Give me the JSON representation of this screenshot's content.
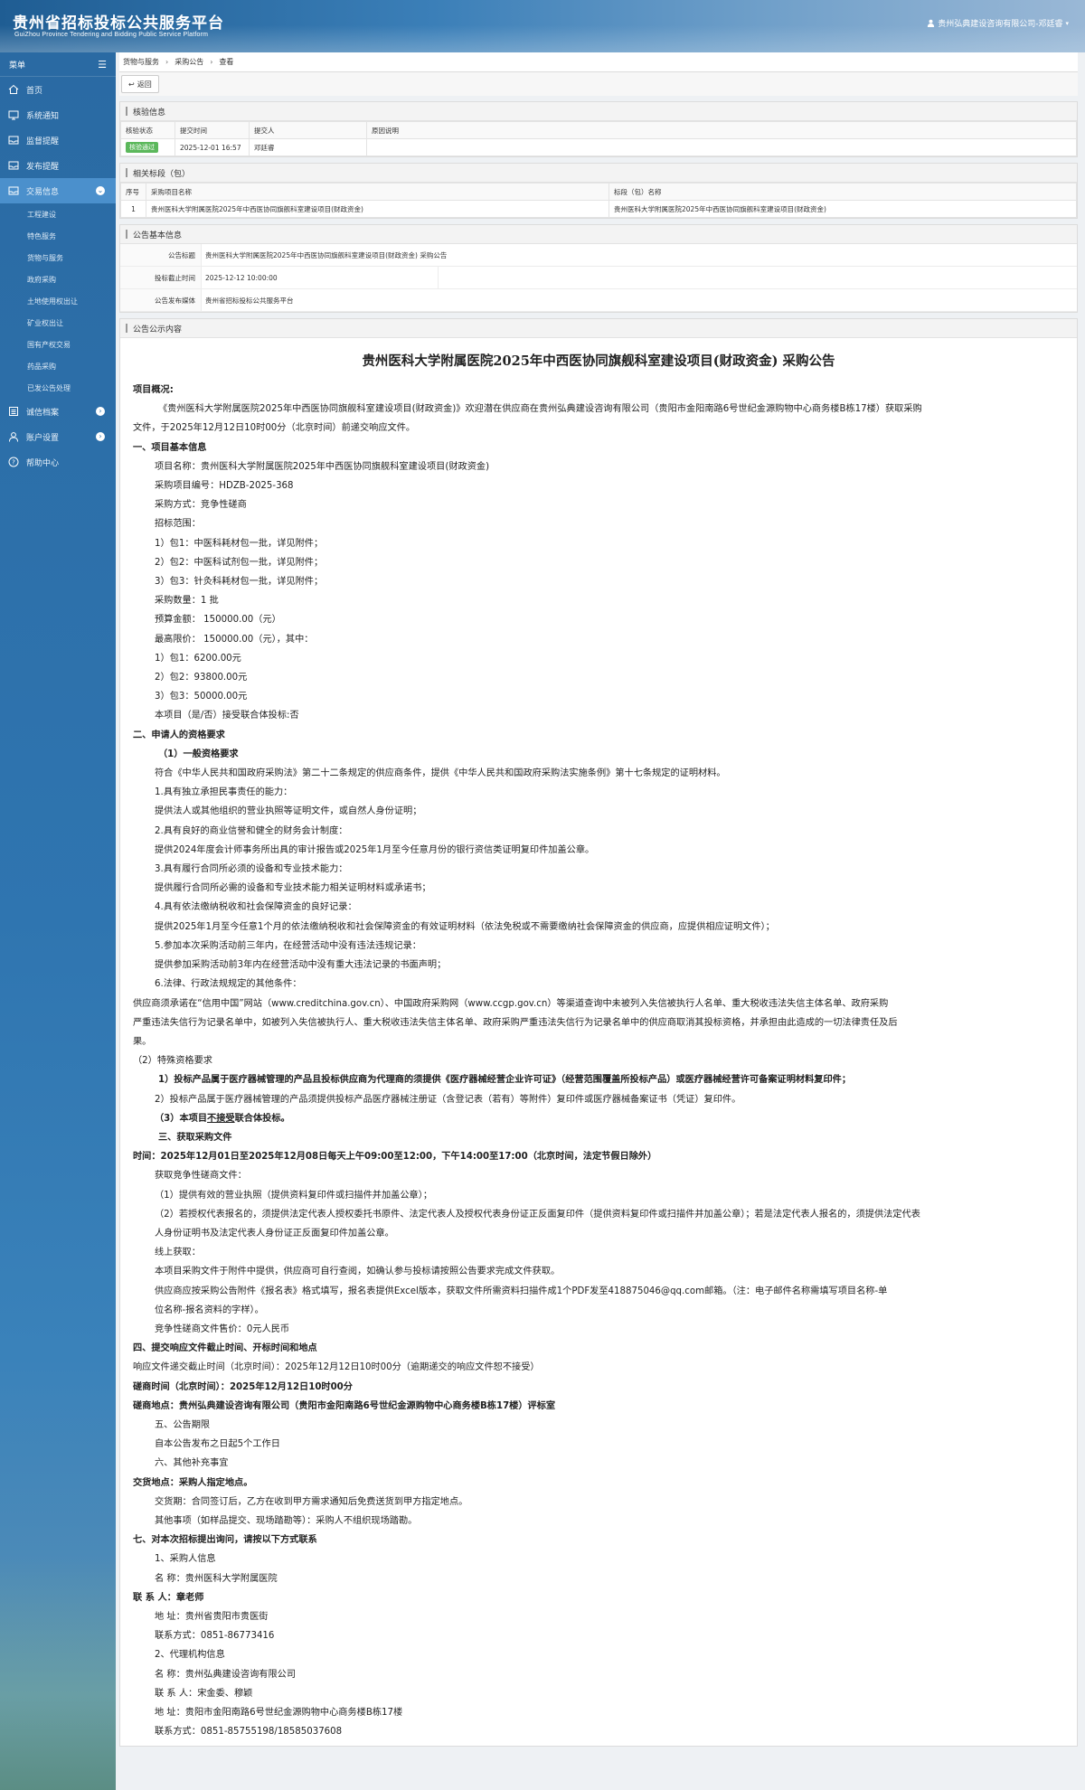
{
  "header": {
    "title": "贵州省招标投标公共服务平台",
    "subtitle": "GuiZhou Province Tendering and Bidding Public Service Platform",
    "user": "贵州弘典建设咨询有限公司-邓廷睿"
  },
  "sidebar": {
    "menu_label": "菜单",
    "items": [
      {
        "label": "首页",
        "icon": "home-icon"
      },
      {
        "label": "系统通知",
        "icon": "monitor-icon"
      },
      {
        "label": "监督提醒",
        "icon": "inbox-icon"
      },
      {
        "label": "发布提醒",
        "icon": "inbox-icon"
      },
      {
        "label": "交易信息",
        "icon": "inbox-icon",
        "active": true
      }
    ],
    "subitems": [
      "工程建设",
      "特色服务",
      "货物与服务",
      "政府采购",
      "土地使用权出让",
      "矿业权出让",
      "国有产权交易",
      "药品采购",
      "已发公告处理"
    ],
    "items2": [
      {
        "label": "诚信档案",
        "icon": "list-icon"
      },
      {
        "label": "账户设置",
        "icon": "user-icon"
      },
      {
        "label": "帮助中心",
        "icon": "help-icon"
      }
    ]
  },
  "breadcrumb": [
    "货物与服务",
    "采购公告",
    "查看"
  ],
  "toolbar": {
    "back_label": "返回"
  },
  "verify": {
    "title": "核验信息",
    "headers": [
      "核验状态",
      "提交时间",
      "提交人",
      "原因说明"
    ],
    "row": {
      "status": "核验通过",
      "time": "2025-12-01 16:57",
      "person": "邓廷睿",
      "reason": ""
    }
  },
  "sections": {
    "title": "相关标段（包）",
    "headers": [
      "序号",
      "采购项目名称",
      "标段（包）名称"
    ],
    "row": {
      "no": "1",
      "project": "贵州医科大学附属医院2025年中西医协同旗舰科室建设项目(财政资金)",
      "section": "贵州医科大学附属医院2025年中西医协同旗舰科室建设项目(财政资金)"
    }
  },
  "basic": {
    "title": "公告基本信息",
    "rows": [
      {
        "label": "公告标题",
        "value": "贵州医科大学附属医院2025年中西医协同旗舰科室建设项目(财政资金) 采购公告"
      },
      {
        "label": "投标截止时间",
        "value": "2025-12-12 10:00:00"
      },
      {
        "label": "公告发布媒体",
        "value": "贵州省招标投标公共服务平台"
      }
    ]
  },
  "content": {
    "title": "公告公示内容",
    "doc_title": "贵州医科大学附属医院2025年中西医协同旗舰科室建设项目(财政资金)      采购公告",
    "lines": [
      "项目概况:",
      "《贵州医科大学附属医院2025年中西医协同旗舰科室建设项目(财政资金)》欢迎潜在供应商在贵州弘典建设咨询有限公司（贵阳市金阳南路6号世纪金源购物中心商务楼B栋17楼）获取采购",
      "文件，于2025年12月12日10时00分（北京时间）前递交响应文件。",
      "一、项目基本信息",
      "项目名称：贵州医科大学附属医院2025年中西医协同旗舰科室建设项目(财政资金)",
      "采购项目编号：HDZB-2025-368",
      "采购方式：竞争性磋商",
      "招标范围：",
      "1）包1：中医科耗材包一批，详见附件；",
      "2）包2：中医科试剂包一批，详见附件；",
      "3）包3：针灸科耗材包一批，详见附件；",
      "采购数量：1 批",
      "预算金额： 150000.00（元）",
      "最高限价： 150000.00（元），其中：",
      "1）包1：6200.00元",
      "2）包2：93800.00元",
      "3）包3：50000.00元",
      "本项目（是/否）接受联合体投标:否",
      "二、申请人的资格要求",
      "（1）一般资格要求",
      "符合《中华人民共和国政府采购法》第二十二条规定的供应商条件，提供《中华人民共和国政府采购法实施条例》第十七条规定的证明材料。",
      "1.具有独立承担民事责任的能力：",
      "提供法人或其他组织的营业执照等证明文件，或自然人身份证明；",
      "2.具有良好的商业信誉和健全的财务会计制度：",
      "提供2024年度会计师事务所出具的审计报告或2025年1月至今任意月份的银行资信类证明复印件加盖公章。",
      "3.具有履行合同所必须的设备和专业技术能力：",
      "提供履行合同所必需的设备和专业技术能力相关证明材料或承诺书；",
      "4.具有依法缴纳税收和社会保障资金的良好记录：",
      "提供2025年1月至今任意1个月的依法缴纳税收和社会保障资金的有效证明材料（依法免税或不需要缴纳社会保障资金的供应商，应提供相应证明文件）；",
      "5.参加本次采购活动前三年内，在经营活动中没有违法违规记录：",
      "提供参加采购活动前3年内在经营活动中没有重大违法记录的书面声明；",
      "6.法律、行政法规规定的其他条件：",
      "供应商须承诺在“信用中国”网站（www.creditchina.gov.cn）、中国政府采购网（www.ccgp.gov.cn）等渠道查询中未被列入失信被执行人名单、重大税收违法失信主体名单、政府采购",
      "严重违法失信行为记录名单中，如被列入失信被执行人、重大税收违法失信主体名单、政府采购严重违法失信行为记录名单中的供应商取消其投标资格，并承担由此造成的一切法律责任及后",
      "果。",
      "（2）特殊资格要求",
      "1）投标产品属于医疗器械管理的产品且投标供应商为代理商的须提供《医疗器械经营企业许可证》（经营范围覆盖所投标产品）或医疗器械经营许可备案证明材料复印件；",
      "2）投标产品属于医疗器械管理的产品须提供投标产品医疗器械注册证（含登记表（若有）等附件）复印件或医疗器械备案证书（凭证）复印件。",
      "（3）本项目不接受联合体投标。",
      "三、获取采购文件",
      "时间：2025年12月01日至2025年12月08日每天上午09:00至12:00，下午14:00至17:00（北京时间，法定节假日除外）",
      "获取竞争性磋商文件：",
      "（1）提供有效的营业执照（提供资料复印件或扫描件并加盖公章）；",
      "（2）若授权代表报名的，须提供法定代表人授权委托书原件、法定代表人及授权代表身份证正反面复印件（提供资料复印件或扫描件并加盖公章）；若是法定代表人报名的，须提供法定代表",
      "人身份证明书及法定代表人身份证正反面复印件加盖公章。",
      "线上获取：",
      "本项目采购文件于附件中提供，供应商可自行查阅，如确认参与投标请按照公告要求完成文件获取。",
      "供应商应按采购公告附件《报名表》格式填写，报名表提供Excel版本，获取文件所需资料扫描件成1个PDF发至418875046@qq.com邮箱。（注：电子邮件名称需填写项目名称-单",
      "位名称-报名资料的字样）。",
      "竞争性磋商文件售价：0元人民币",
      "四、提交响应文件截止时间、开标时间和地点",
      "响应文件递交截止时间（北京时间）：2025年12月12日10时00分（逾期递交的响应文件恕不接受）",
      "磋商时间（北京时间）：2025年12月12日10时00分",
      "磋商地点：贵州弘典建设咨询有限公司（贵阳市金阳南路6号世纪金源购物中心商务楼B栋17楼）评标室",
      "五、公告期限",
      "自本公告发布之日起5个工作日",
      "六、其他补充事宜",
      "交货地点：采购人指定地点。",
      "交货期：合同签订后，乙方在收到甲方需求通知后免费送货到甲方指定地点。",
      "其他事项（如样品提交、现场踏勘等）：采购人不组织现场踏勘。",
      "七、对本次招标提出询问，请按以下方式联系",
      "1、采购人信息",
      "名        称：贵州医科大学附属医院",
      "联 系 人：章老师",
      "地        址：贵州省贵阳市贵医街",
      "联系方式：0851-86773416",
      "2、代理机构信息",
      "名        称：贵州弘典建设咨询有限公司",
      "联 系 人：宋金委、穆颖",
      "地        址：贵阳市金阳南路6号世纪金源购物中心商务楼B栋17楼",
      "联系方式：0851-85755198/18585037608"
    ]
  }
}
